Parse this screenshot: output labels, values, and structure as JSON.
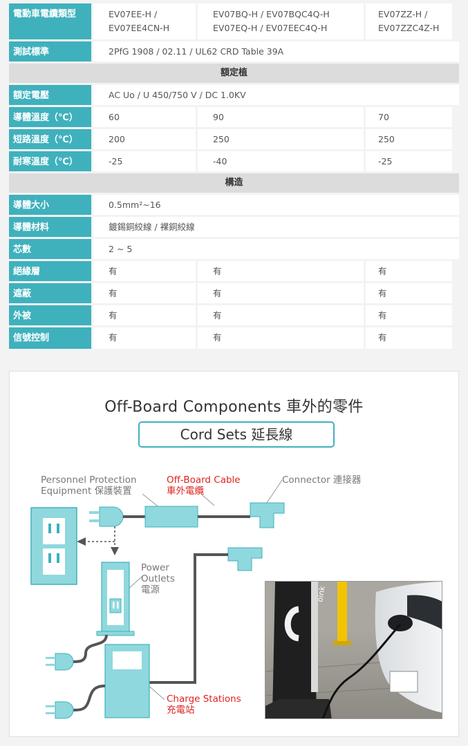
{
  "table": {
    "header": {
      "label": "電動車電纜類型",
      "models": [
        "EV07EE-H / EV07EE4CN-H",
        "EV07BQ-H / EV07BQC4Q-H EV07EQ-H / EV07EEC4Q-H",
        "EV07ZZ-H / EV07ZZC4Z-H"
      ]
    },
    "standard": {
      "label": "測試標準",
      "value": "2PfG 1908 / 02.11 / UL62 CRD Table 39A"
    },
    "section_ratings": "額定植",
    "voltage": {
      "label": "額定電壓",
      "value": "AC Uo / U 450/750 V / DC 1.0KV"
    },
    "conductor_temp": {
      "label": "導體溫度（℃）",
      "values": [
        "60",
        "90",
        "70"
      ]
    },
    "short_circuit_temp": {
      "label": "短路溫度（℃）",
      "values": [
        "200",
        "250",
        "250"
      ]
    },
    "cold_temp": {
      "label": "耐寒溫度（℃）",
      "values": [
        "-25",
        "-40",
        "-25"
      ]
    },
    "section_construction": "構造",
    "conductor_size": {
      "label": "導體大小",
      "value": "0.5mm²~16"
    },
    "conductor_material": {
      "label": "導體材料",
      "value": "鍍錫銅絞線 / 裸銅絞線"
    },
    "cores": {
      "label": "芯數",
      "value": "2 ~ 5"
    },
    "insulation": {
      "label": "絕緣層",
      "values": [
        "有",
        "有",
        "有"
      ]
    },
    "shielding": {
      "label": "遮蔽",
      "values": [
        "有",
        "有",
        "有"
      ]
    },
    "jacket": {
      "label": "外被",
      "values": [
        "有",
        "有",
        "有"
      ]
    },
    "signal": {
      "label": "信號控制",
      "values": [
        "有",
        "有",
        "有"
      ]
    }
  },
  "components": {
    "title": "Off-Board Components 車外的零件",
    "subtitle": "Cord Sets 延長線",
    "labels": {
      "ppe_1": "Personnel Protection",
      "ppe_2": "Equipment 保護裝置",
      "cable_1": "Off-Board Cable",
      "cable_2": "車外電纜",
      "connector": "Connector 連接器",
      "outlets_1": "Power",
      "outlets_2": "Outlets",
      "outlets_3": "電源",
      "stations_1": "Charge Stations",
      "stations_2": "充電站"
    },
    "photo_sign_text": "oink"
  },
  "colors": {
    "accent": "#3fb1bd",
    "icon_fill": "#8fd8dd",
    "red_label": "#e0211d",
    "section_gray": "#dcdcdc"
  }
}
